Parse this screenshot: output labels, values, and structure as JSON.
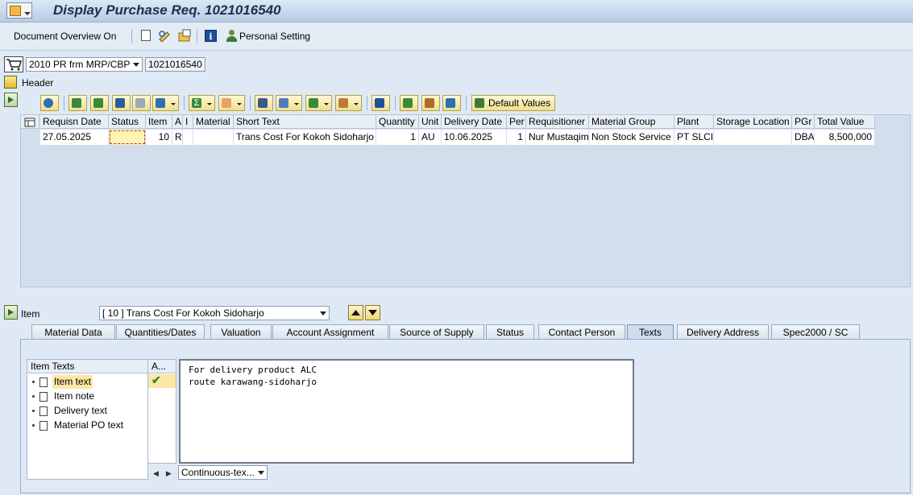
{
  "title": "Display Purchase Req. 1021016540",
  "toolbar": {
    "doc_overview": "Document Overview On",
    "personal_setting": "Personal Setting"
  },
  "doc_header": {
    "doc_type": "2010 PR frm MRP/CBP",
    "doc_number": "1021016540",
    "header_label": "Header"
  },
  "grid_toolbar": {
    "default_values": "Default Values"
  },
  "table": {
    "columns": [
      "Requisn Date",
      "Status",
      "Item",
      "A",
      "I",
      "Material",
      "Short Text",
      "Quantity",
      "Unit",
      "Delivery Date",
      "Per",
      "Requisitioner",
      "Material Group",
      "Plant",
      "Storage Location",
      "PGr",
      "Total Value"
    ],
    "rows": [
      {
        "requisn_date": "27.05.2025",
        "status": "",
        "item": "10",
        "a": "R",
        "i": "",
        "material": "",
        "short_text": "Trans Cost For Kokoh Sidoharjo",
        "quantity": "1",
        "unit": "AU",
        "delivery_date": "10.06.2025",
        "per": "1",
        "requisitioner": "Nur Mustaqim",
        "material_group": "Non Stock Service",
        "plant": "PT SLCI",
        "storage_location": "",
        "pgr": "DBA",
        "total_value": "8,500,000"
      }
    ]
  },
  "item_section": {
    "label": "Item",
    "selected_item": "[ 10 ] Trans Cost For Kokoh Sidoharjo"
  },
  "tabs": [
    "Material Data",
    "Quantities/Dates",
    "Valuation",
    "Account Assignment",
    "Source of Supply",
    "Status",
    "Contact Person",
    "Texts",
    "Delivery Address",
    "Spec2000 / SC"
  ],
  "active_tab": "Texts",
  "texts": {
    "tree_header": "Item Texts",
    "tree_header_a": "A...",
    "items": [
      "Item text",
      "Item note",
      "Delivery text",
      "Material PO text"
    ],
    "selected_item": "Item text",
    "editor_lines": [
      "For delivery product ALC",
      "route karawang-sidoharjo"
    ],
    "format": "Continuous-tex..."
  },
  "colors": {
    "accent_yellow": "#fde7a4",
    "panel_bg": "#dfe9f5",
    "check_green": "#2d8a2d"
  }
}
